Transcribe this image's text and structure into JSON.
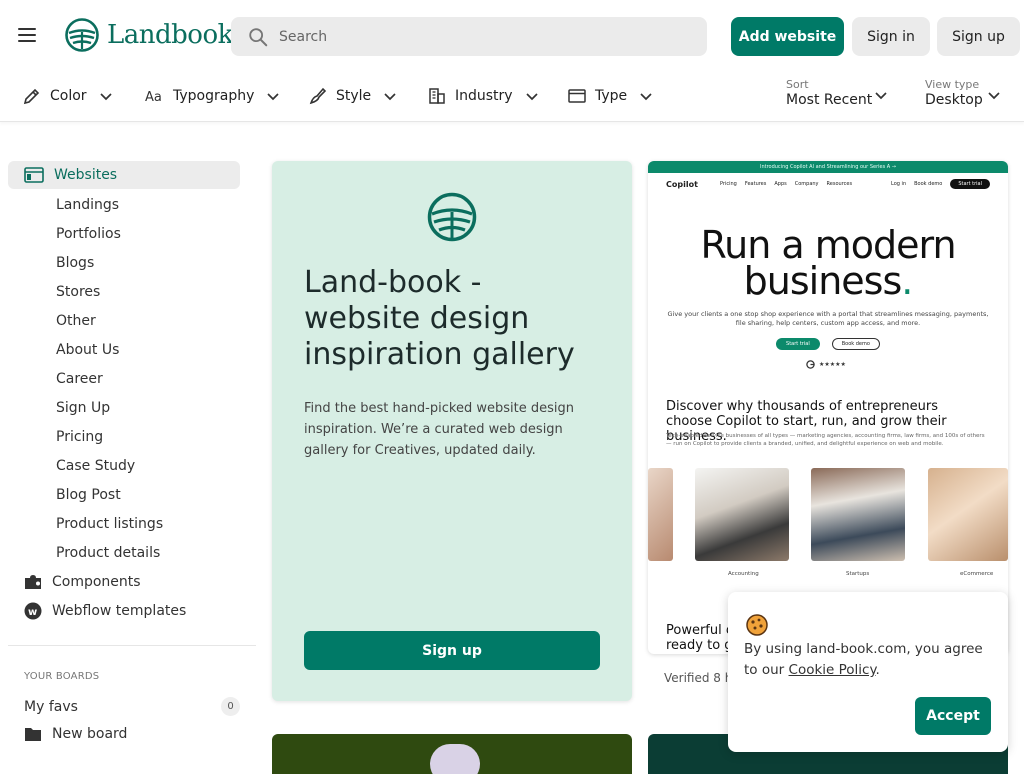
{
  "header": {
    "logo_text": "Landbook",
    "search_placeholder": "Search",
    "add_website": "Add website",
    "sign_in": "Sign in",
    "sign_up": "Sign up"
  },
  "filters": {
    "color": "Color",
    "typography": "Typography",
    "style": "Style",
    "industry": "Industry",
    "type": "Type",
    "sort_label": "Sort",
    "sort_value": "Most Recent",
    "view_label": "View type",
    "view_value": "Desktop"
  },
  "sidebar": {
    "active": "Websites",
    "sub_items": [
      "Landings",
      "Portfolios",
      "Blogs",
      "Stores",
      "Other",
      "About Us",
      "Career",
      "Sign Up",
      "Pricing",
      "Case Study",
      "Blog Post",
      "Product listings",
      "Product details"
    ],
    "components": "Components",
    "webflow": "Webflow templates",
    "boards_title": "YOUR BOARDS",
    "my_favs": "My favs",
    "my_favs_count": "0",
    "new_board": "New board"
  },
  "promo": {
    "title": "Land-book - website design inspiration gallery",
    "description": "Find the best hand-picked website design inspiration. We’re a curated web design gallery for Creatives, updated daily.",
    "button": "Sign up"
  },
  "site_card": {
    "top_banner": "Introducing Copilot AI and Streamlining our Series A →",
    "brand": "Copilot",
    "nav_links": [
      "Pricing",
      "Features",
      "Apps",
      "Company",
      "Resources"
    ],
    "login": "Log in",
    "book_demo": "Book demo",
    "start_trial": "Start trial",
    "headline_1": "Run a modern",
    "headline_2": "business",
    "headline_dot": ".",
    "subtext": "Give your clients a one stop shop experience with a portal that streamlines messaging, payments, file sharing, help centers, custom app access, and more.",
    "btn_trial": "Start trial",
    "btn_demo": "Book demo",
    "rating": "★★★★★",
    "section_heading": "Discover why thousands of entrepreneurs choose Copilot to start, run, and grow their business.",
    "section_text": "Tech-enabled service businesses of all types — marketing agencies, accounting firms, law firms, and 100s of others — run on Copilot to provide clients a branded, unified, and delightful experience on web and mobile.",
    "captions": [
      "Accounting",
      "Startups",
      "eCommerce"
    ],
    "footer_text": "Powerful o... ready to go",
    "verified": "Verified 8 ho"
  },
  "cookie": {
    "text_before": "By using land-book.com, you agree to our ",
    "link": "Cookie Policy",
    "text_after": ".",
    "accept": "Accept"
  },
  "colors": {
    "brand": "#007a67",
    "promo_bg": "#d7eee4",
    "chip_bg": "#ebebeb"
  }
}
